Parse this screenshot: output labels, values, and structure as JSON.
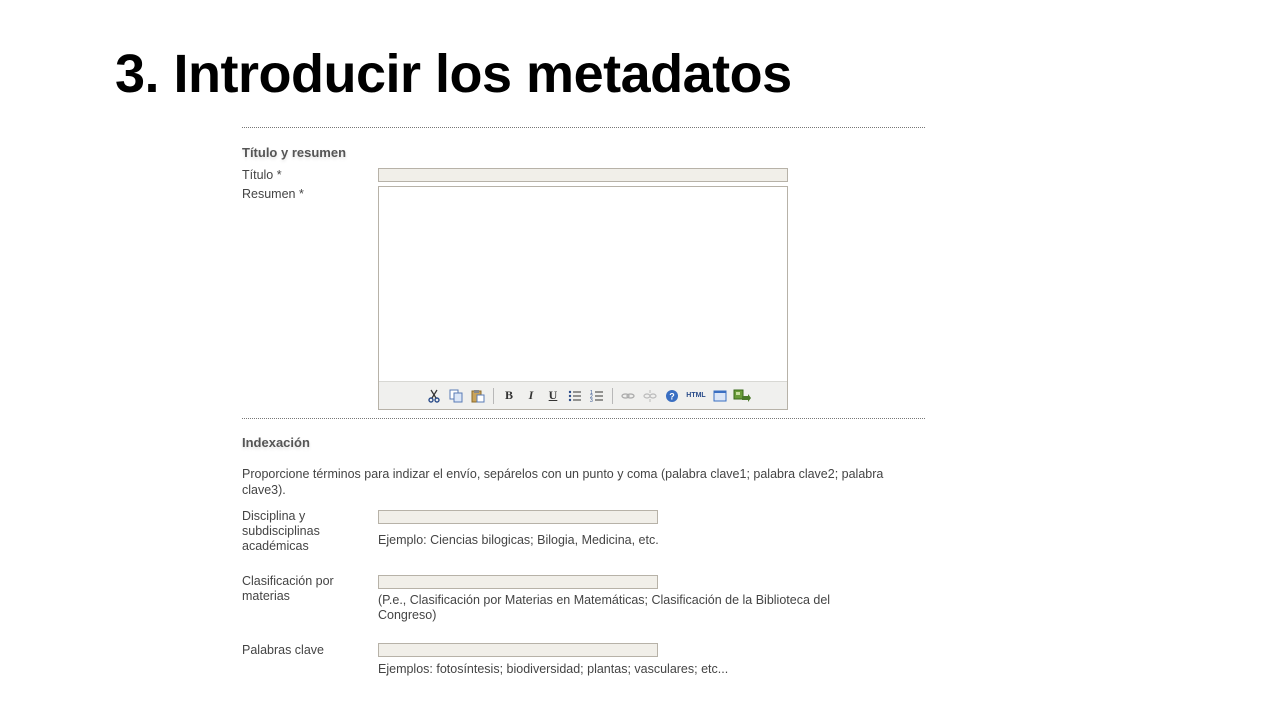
{
  "slide": {
    "title": "3. Introducir los metadatos"
  },
  "title_section": {
    "heading": "Título y resumen",
    "titulo_label": "Título *",
    "titulo_value": "",
    "resumen_label": "Resumen *",
    "resumen_value": ""
  },
  "toolbar": {
    "buttons": [
      "cut-icon",
      "copy-icon",
      "paste-icon",
      "bold-icon",
      "italic-icon",
      "underline-icon",
      "bullet-list-icon",
      "numbered-list-icon",
      "link-icon",
      "unlink-icon",
      "help-icon",
      "html-icon",
      "fullscreen-icon",
      "image-upload-icon"
    ],
    "bold": "B",
    "italic": "I",
    "underline": "U",
    "html": "HTML"
  },
  "indexing": {
    "heading": "Indexación",
    "intro": "Proporcione términos para indizar el envío, sepárelos con un punto y coma (palabra clave1; palabra clave2; palabra clave3).",
    "disciplina_label": "Disciplina y subdisciplinas académicas",
    "disciplina_hint": "Ejemplo: Ciencias bilogicas; Bilogia, Medicina, etc.",
    "disciplina_value": "",
    "clasificacion_label": "Clasificación por materias",
    "clasificacion_hint": "(P.e., Clasificación por Materias en Matemáticas; Clasificación de la Biblioteca del Congreso)",
    "clasificacion_value": "",
    "palabras_label": "Palabras clave",
    "palabras_hint": "Ejemplos: fotosíntesis; biodiversidad; plantas; vasculares; etc...",
    "palabras_value": ""
  }
}
